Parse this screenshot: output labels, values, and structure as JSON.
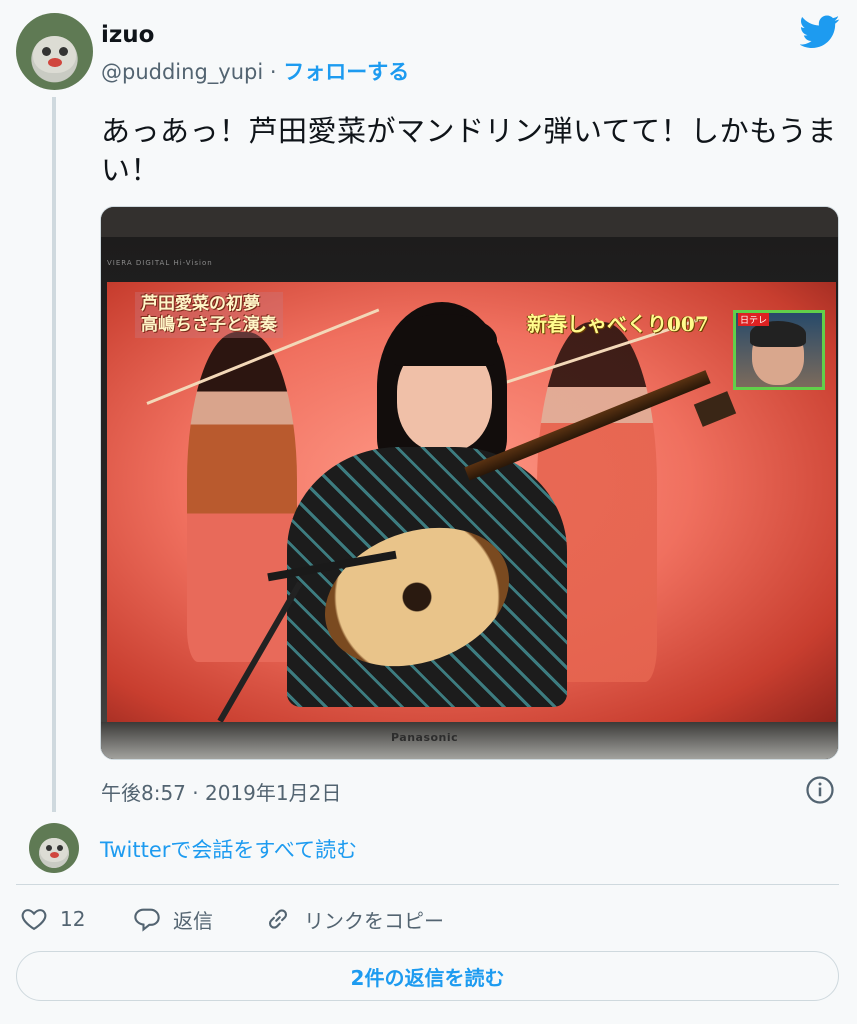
{
  "author": {
    "name": "izuo",
    "handle": "@pudding_yupi",
    "separator": "·",
    "follow_label": "フォローする"
  },
  "tweet": {
    "text": "あっあっ！芦田愛菜がマンドリン弾いてて！しかもうまい！",
    "timestamp": "午後8:57 · 2019年1月2日"
  },
  "media": {
    "tv_brand_top": "VIERA  DIGITAL Hi-Vision",
    "tv_logo": "Panasonic",
    "caption_left_line1": "芦田愛菜の初夢",
    "caption_left_line2": "高嶋ちさ子と演奏",
    "caption_right": "新春しゃべくり007",
    "inset_label": "日テレ"
  },
  "conversation": {
    "read_all_label": "Twitterで会話をすべて読む"
  },
  "actions": {
    "like_count": "12",
    "reply_label": "返信",
    "copy_link_label": "リンクをコピー"
  },
  "replies_button_label": "2件の返信を読む",
  "colors": {
    "accent": "#1d9bf0",
    "secondary_text": "#536471",
    "background": "#f7f9fa"
  },
  "icons": [
    "twitter-logo-icon",
    "info-icon",
    "heart-icon",
    "reply-icon",
    "link-icon"
  ]
}
